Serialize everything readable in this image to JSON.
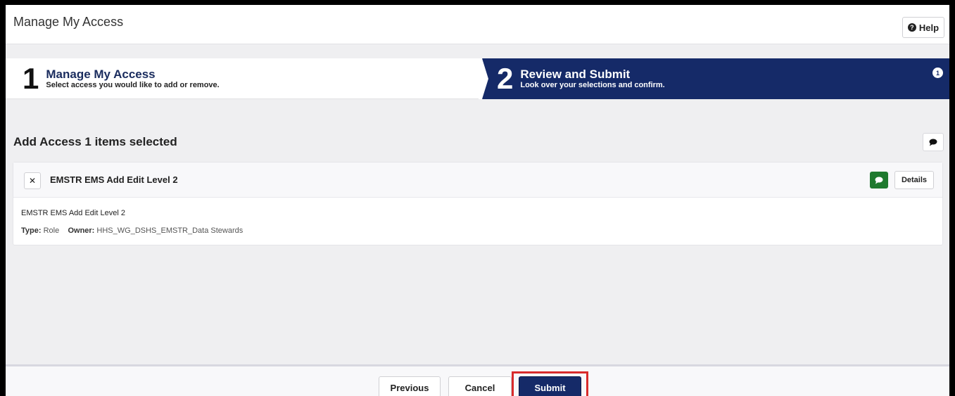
{
  "header": {
    "title": "Manage My Access",
    "help_label": "Help",
    "help_icon": "question-circle-icon"
  },
  "steps": [
    {
      "number": "1",
      "title": "Manage My Access",
      "subtitle": "Select access you would like to add or remove."
    },
    {
      "number": "2",
      "title": "Review and Submit",
      "subtitle": "Look over your selections and confirm.",
      "badge": "1"
    }
  ],
  "section": {
    "title": "Add Access 1 items selected",
    "comment_icon": "comment-icon"
  },
  "item": {
    "remove_icon": "close-icon",
    "title": "EMSTR EMS Add Edit Level 2",
    "details_label": "Details",
    "name": "EMSTR EMS Add Edit Level 2",
    "type_label": "Type:",
    "type_value": "Role",
    "owner_label": "Owner:",
    "owner_value": "HHS_WG_DSHS_EMSTR_Data Stewards"
  },
  "footer": {
    "previous_label": "Previous",
    "cancel_label": "Cancel",
    "submit_label": "Submit"
  },
  "colors": {
    "primary_navy": "#152a68",
    "comment_green": "#1f7a2e",
    "highlight_red": "#d82b2b",
    "background": "#efeff1"
  }
}
